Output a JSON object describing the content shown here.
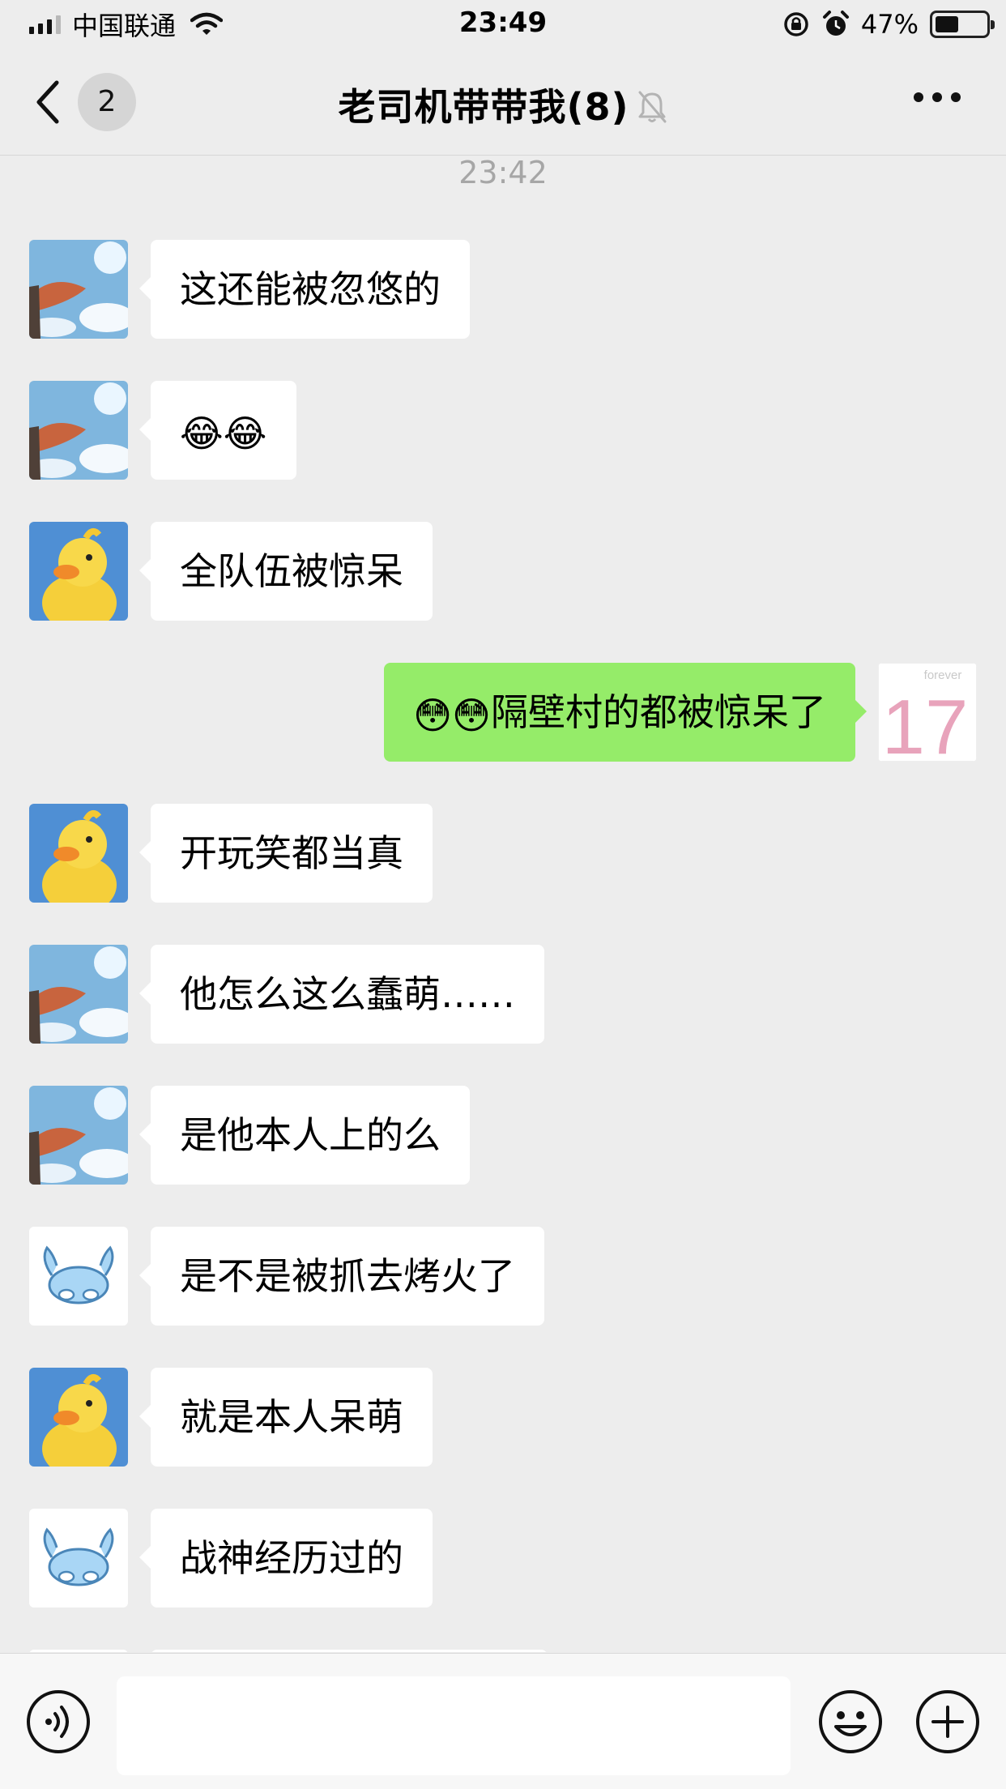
{
  "status_bar": {
    "carrier": "中国联通",
    "time": "23:49",
    "battery_percent": "47%",
    "battery_level": 0.47
  },
  "nav": {
    "unread_count": "2",
    "title": "老司机带带我(8)",
    "icons": {
      "back": "chevron-left-icon",
      "mute": "bell-off-icon",
      "more": "ellipsis-icon"
    }
  },
  "chat": {
    "timestamp": "23:42",
    "messages": [
      {
        "side": "in",
        "sender": "sky-avatar",
        "text": "这还能被忽悠的"
      },
      {
        "side": "in",
        "sender": "sky-avatar",
        "emoji": [
          "😂",
          "😂"
        ],
        "text": ""
      },
      {
        "side": "in",
        "sender": "duck-avatar",
        "text": "全队伍被惊呆"
      },
      {
        "side": "out",
        "sender": "self-avatar",
        "emoji": [
          "😳",
          "😳"
        ],
        "text": "隔壁村的都被惊呆了"
      },
      {
        "side": "in",
        "sender": "duck-avatar",
        "text": "开玩笑都当真"
      },
      {
        "side": "in",
        "sender": "sky-avatar",
        "text": "他怎么这么蠢萌……"
      },
      {
        "side": "in",
        "sender": "sky-avatar",
        "text": "是他本人上的么"
      },
      {
        "side": "in",
        "sender": "crab-avatar",
        "text": "是不是被抓去烤火了"
      },
      {
        "side": "in",
        "sender": "duck-avatar",
        "text": "就是本人呆萌"
      },
      {
        "side": "in",
        "sender": "crab-avatar",
        "text": "战神经历过的"
      }
    ],
    "self_avatar_text": {
      "small": "forever",
      "big": "17"
    }
  },
  "input_bar": {
    "placeholder": "",
    "icons": {
      "voice": "voice-icon",
      "emoji": "smiley-icon",
      "plus": "plus-icon"
    }
  },
  "colors": {
    "background": "#ededed",
    "incoming_bubble": "#ffffff",
    "outgoing_bubble": "#95ec69",
    "timestamp": "#a6a6a6"
  }
}
